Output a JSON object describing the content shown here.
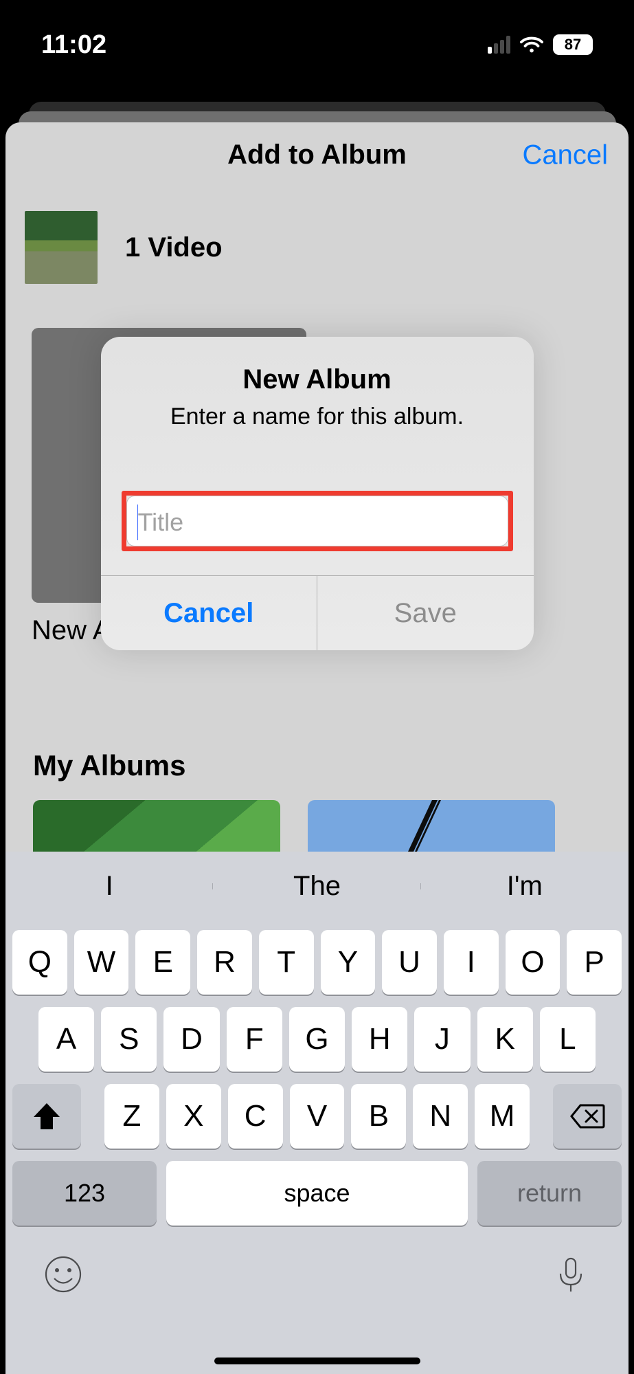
{
  "status_bar": {
    "time": "11:02",
    "battery_percent": "87"
  },
  "sheet": {
    "title": "Add to Album",
    "cancel_label": "Cancel",
    "item_summary": "1 Video",
    "new_album_tile_label": "New Album...",
    "my_albums_header": "My Albums"
  },
  "alert": {
    "title": "New Album",
    "subtitle": "Enter a name for this album.",
    "input_placeholder": "Title",
    "input_value": "",
    "cancel_label": "Cancel",
    "save_label": "Save"
  },
  "keyboard": {
    "predictions": [
      "I",
      "The",
      "I'm"
    ],
    "row1": [
      "Q",
      "W",
      "E",
      "R",
      "T",
      "Y",
      "U",
      "I",
      "O",
      "P"
    ],
    "row2": [
      "A",
      "S",
      "D",
      "F",
      "G",
      "H",
      "J",
      "K",
      "L"
    ],
    "row3": [
      "Z",
      "X",
      "C",
      "V",
      "B",
      "N",
      "M"
    ],
    "mode_key": "123",
    "space_label": "space",
    "return_label": "return"
  }
}
